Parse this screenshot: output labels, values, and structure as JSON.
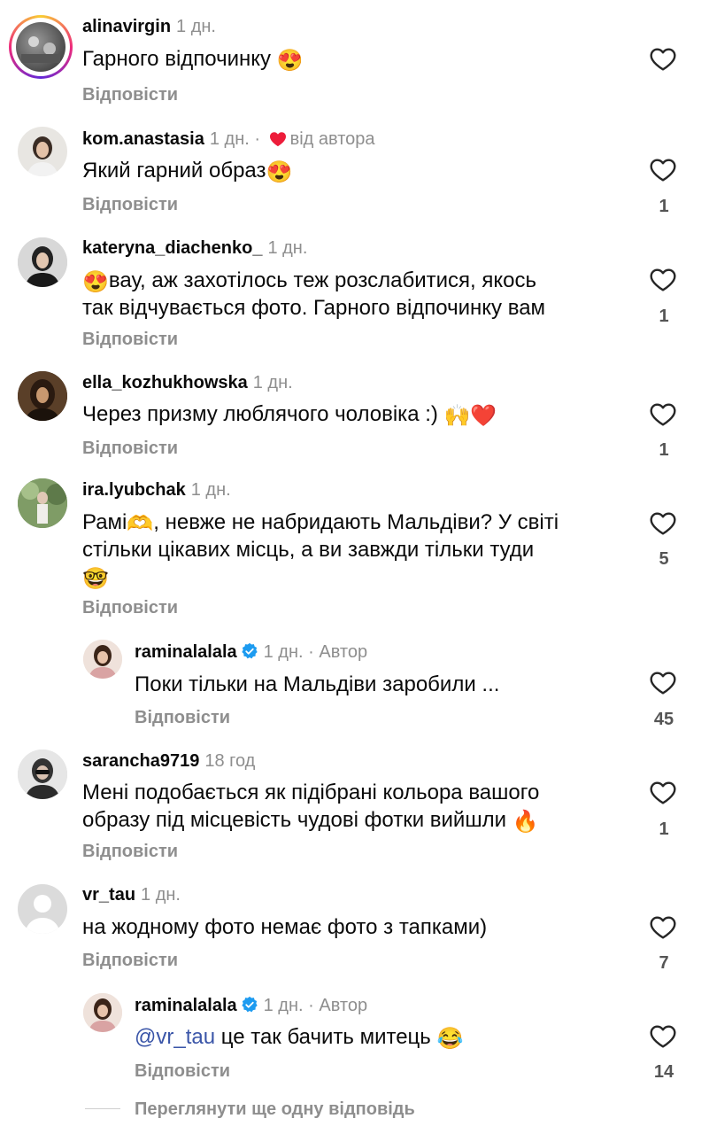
{
  "reply_label": "Відповісти",
  "view_more": "Переглянути ще одну відповідь",
  "author_label": "Автор",
  "dot": "·",
  "comments": [
    {
      "username": "alinavirgin",
      "time": "1 дн.",
      "text": "Гарного відпочинку",
      "emoji": "😍",
      "likes": ""
    },
    {
      "username": "kom.anastasia",
      "time": "1 дн.",
      "liked_by_author": "від автора",
      "text": "Який гарний образ",
      "emoji": "😍",
      "likes": "1"
    },
    {
      "username": "kateryna_diachenko_",
      "time": "1 дн.",
      "emoji_lead": "😍",
      "text_line1": "вау, аж захотілось теж розслабитися, якось",
      "text_line2": "так відчувається фото. Гарного відпочинку вам",
      "likes": "1"
    },
    {
      "username": "ella_kozhukhowska",
      "time": "1 дн.",
      "text": "Через призму люблячого чоловіка :) ",
      "emoji": "🙌❤️",
      "likes": "1"
    },
    {
      "username": "ira.lyubchak",
      "time": "1 дн.",
      "text_a": "Рамі",
      "emoji_a": "🫶",
      "text_line1": ", невже не набридають Мальдіви? У світі",
      "text_line2": "стільки цікавих місць, а ви завжди тільки туди",
      "emoji_line3": "🤓",
      "likes": "5"
    },
    {
      "username": "raminalalala",
      "time": "1 дн.",
      "text": "Поки тільки на Мальдіви заробили ...",
      "likes": "45"
    },
    {
      "username": "sarancha9719",
      "time": "18 год",
      "text_line1": "Мені подобається як підібрані кольора вашого",
      "text_line2": "образу під місцевість чудові фотки вийшли ",
      "emoji": "🔥",
      "likes": "1"
    },
    {
      "username": "vr_tau",
      "time": "1 дн.",
      "text": "на жодному фото немає фото з тапками)",
      "likes": "7"
    },
    {
      "username": "raminalalala",
      "time": "1 дн.",
      "mention": "@vr_tau",
      "text": " це так бачить митець ",
      "emoji": "😂",
      "likes": "14"
    }
  ],
  "colors": {
    "accent_link": "#3a55a8",
    "like_red": "#ed1c3a",
    "verified_blue": "#1d9bf0",
    "muted": "#8e8e8e"
  }
}
